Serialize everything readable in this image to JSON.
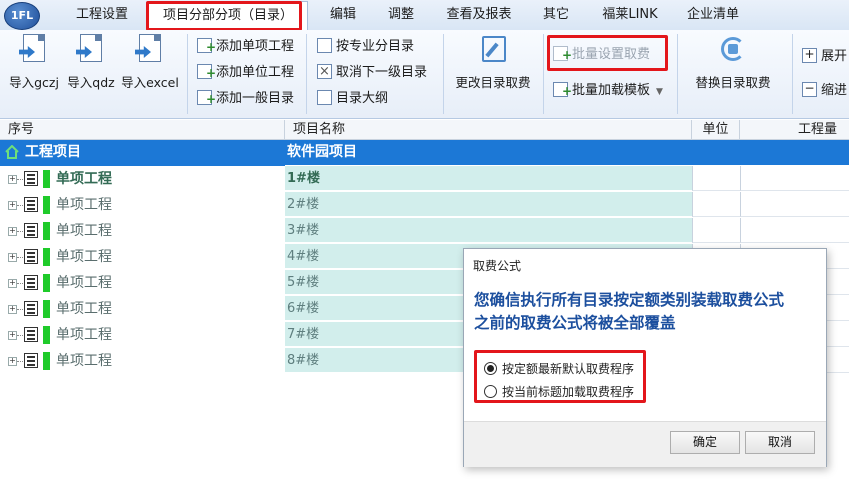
{
  "app": {
    "logo_text": "1FL"
  },
  "menu": {
    "items": [
      "工程设置",
      "项目分部分项（目录）",
      "编辑",
      "调整",
      "查看及报表",
      "其它",
      "福莱LINK",
      "企业清单"
    ],
    "active_index": 1
  },
  "ribbon": {
    "import_gczj": "导入gczj",
    "import_qdz": "导入qdz",
    "import_excel": "导入excel",
    "add_single_project": "添加单项工程",
    "add_unit_project": "添加单位工程",
    "add_general_dir": "添加一般目录",
    "by_specialty": "按专业分目录",
    "cancel_lower_level": "取消下一级目录",
    "dir_outline": "目录大纲",
    "change_dir_fee": "更改目录取费",
    "batch_set_fee": "批量设置取费",
    "batch_load_template": "批量加载模板",
    "replace_dir_fee": "替换目录取费",
    "expand": "展开",
    "collapse": "缩进"
  },
  "table": {
    "headers": [
      "序号",
      "项目名称",
      "单位",
      "工程量"
    ],
    "root": {
      "label": "工程项目",
      "name": "软件园项目"
    },
    "rows": [
      {
        "label": "单项工程",
        "name": "1#楼"
      },
      {
        "label": "单项工程",
        "name": "2#楼"
      },
      {
        "label": "单项工程",
        "name": "3#楼"
      },
      {
        "label": "单项工程",
        "name": "4#楼"
      },
      {
        "label": "单项工程",
        "name": "5#楼"
      },
      {
        "label": "单项工程",
        "name": "6#楼"
      },
      {
        "label": "单项工程",
        "name": "7#楼"
      },
      {
        "label": "单项工程",
        "name": "8#楼"
      }
    ]
  },
  "dialog": {
    "title": "取费公式",
    "message_line1": "您确信执行所有目录按定额类别装载取费公式",
    "message_line2": "之前的取费公式将被全部覆盖",
    "option1": "按定额最新默认取费程序",
    "option2": "按当前标题加载取费程序",
    "selected_option": 1,
    "ok": "确定",
    "cancel": "取消"
  },
  "colors": {
    "highlight": "#e3161b",
    "selection": "#1c78d6",
    "row_fill": "#d2eeec",
    "accent_text": "#1c4f9e"
  }
}
